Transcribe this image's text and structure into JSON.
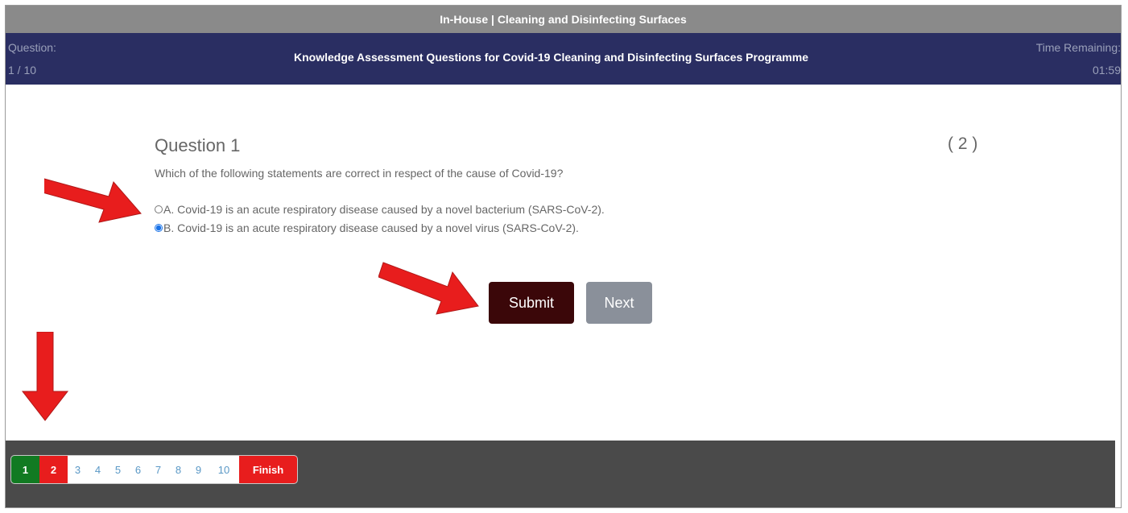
{
  "topbar": {
    "title": "In-House | Cleaning and Disinfecting Surfaces"
  },
  "header": {
    "question_label": "Question:",
    "question_count": "1 / 10",
    "title": "Knowledge Assessment Questions for Covid-19 Cleaning and Disinfecting Surfaces Programme",
    "time_label": "Time Remaining:",
    "time_value": "01:59"
  },
  "question": {
    "heading": "Question 1",
    "marks": "( 2 )",
    "text": "Which of the following statements are correct in respect of the cause of Covid-19?",
    "options": [
      {
        "label": "A. Covid-19 is an acute respiratory disease caused by a novel bacterium (SARS-CoV-2).",
        "selected": false
      },
      {
        "label": "B. Covid-19 is an acute respiratory disease caused by a novel virus (SARS-CoV-2).",
        "selected": true
      }
    ]
  },
  "actions": {
    "submit_label": "Submit",
    "next_label": "Next"
  },
  "pager": {
    "pages": [
      "1",
      "2",
      "3",
      "4",
      "5",
      "6",
      "7",
      "8",
      "9",
      "10"
    ],
    "finish_label": "Finish",
    "current": "1",
    "flagged": "2"
  },
  "colors": {
    "header_bg": "#2a2e62",
    "submit_bg": "#3b0709",
    "next_bg": "#8a909a",
    "current_page": "#117a22",
    "flagged_page": "#e81d1d",
    "annotation_arrow": "#e81d1d"
  },
  "annotations": {
    "arrow_icon": "red-arrow-icon"
  }
}
